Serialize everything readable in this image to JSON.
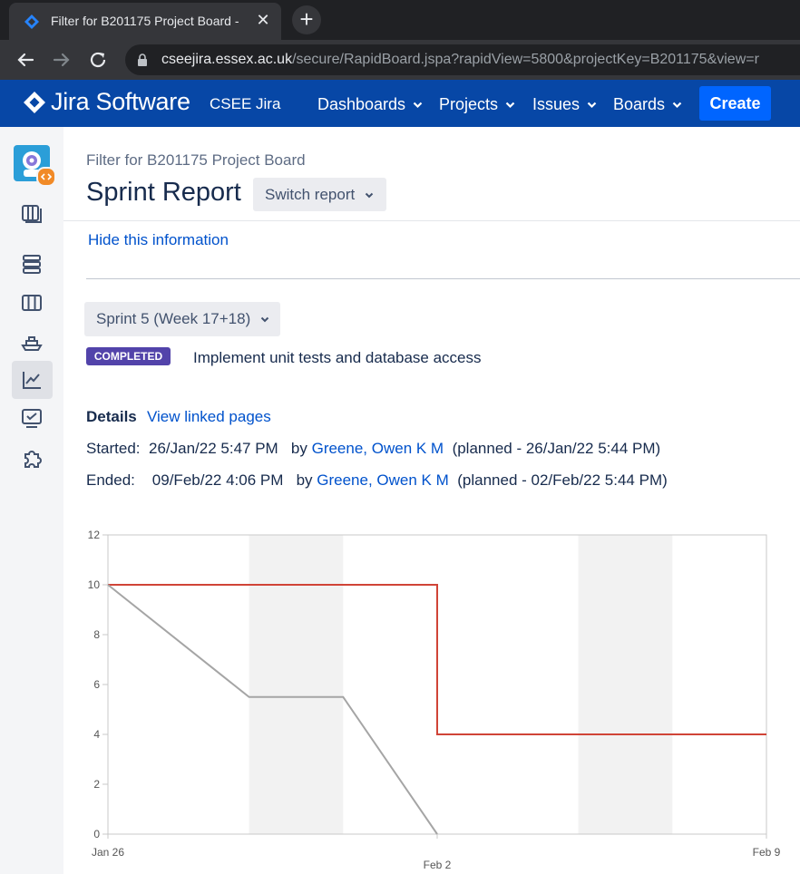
{
  "browser": {
    "tab_title": "Filter for B201175 Project Board -",
    "url_host": "cseejira.essex.ac.uk",
    "url_path": "/secure/RapidBoard.jspa?rapidView=5800&projectKey=B201175&view=r"
  },
  "header": {
    "brand": "Jira Software",
    "instance": "CSEE Jira",
    "nav": [
      "Dashboards",
      "Projects",
      "Issues",
      "Boards"
    ],
    "create_label": "Create",
    "accent": "#0747a6",
    "create_color": "#0065ff"
  },
  "sidebar": {
    "icons": [
      "project-avatar-icon",
      "board-icon",
      "backlog-icon",
      "active-sprints-icon",
      "releases-icon",
      "reports-icon",
      "issues-icon",
      "add-ons-icon"
    ],
    "active": "reports-icon"
  },
  "page": {
    "breadcrumb": "Filter for B201175 Project Board",
    "title": "Sprint Report",
    "switch_report": "Switch report",
    "hide_info": "Hide this information",
    "sprint_name": "Sprint 5 (Week 17+18)",
    "status": "COMPLETED",
    "status_color": "#5243aa",
    "goal": "Implement unit tests and database access",
    "details_label": "Details",
    "linked_pages": "View linked pages",
    "started": {
      "label": "Started:",
      "date": "26/Jan/22 5:47 PM",
      "by": "by",
      "user": "Greene, Owen K M",
      "planned": "(planned - 26/Jan/22 5:44 PM)"
    },
    "ended": {
      "label": "Ended:",
      "date": "09/Feb/22 4:06 PM",
      "by": "by",
      "user": "Greene, Owen K M",
      "planned": "(planned - 02/Feb/22 5:44 PM)"
    }
  },
  "chart_data": {
    "type": "line",
    "x_range": [
      "2022-01-26",
      "2022-02-09"
    ],
    "x_ticks": [
      {
        "date": "2022-01-26",
        "label": "Jan 26"
      },
      {
        "date": "2022-02-02",
        "label": "Feb 2"
      },
      {
        "date": "2022-02-09",
        "label": "Feb 9"
      }
    ],
    "ylim": [
      0,
      12
    ],
    "y_ticks": [
      0,
      2,
      4,
      6,
      8,
      10,
      12
    ],
    "grid": false,
    "non_working_days": [
      [
        "2022-01-29",
        "2022-01-31"
      ],
      [
        "2022-02-05",
        "2022-02-07"
      ]
    ],
    "series": [
      {
        "color": "#d04437",
        "step": true,
        "points": [
          {
            "x": "2022-01-26",
            "y": 10
          },
          {
            "x": "2022-02-02",
            "y": 10
          },
          {
            "x": "2022-02-02",
            "y": 4
          },
          {
            "x": "2022-02-09",
            "y": 4
          }
        ]
      },
      {
        "color": "#a5a5a5",
        "step": false,
        "points": [
          {
            "x": "2022-01-26",
            "y": 10
          },
          {
            "x": "2022-01-29",
            "y": 5.5
          },
          {
            "x": "2022-01-31",
            "y": 5.5
          },
          {
            "x": "2022-02-02",
            "y": 0
          }
        ]
      }
    ]
  }
}
